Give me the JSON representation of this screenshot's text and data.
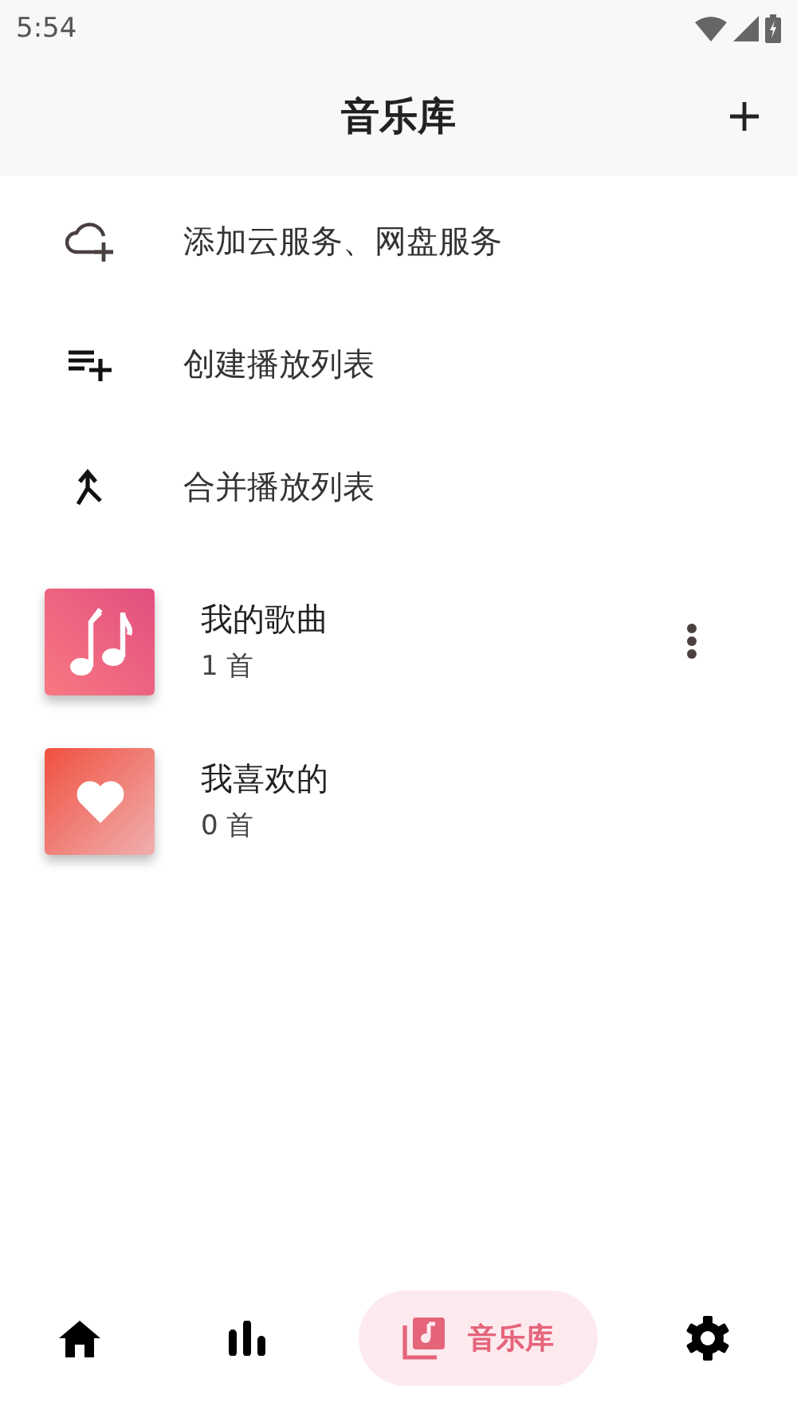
{
  "status_bar": {
    "time": "5:54"
  },
  "header": {
    "title": "音乐库"
  },
  "actions": [
    {
      "kind": "cloud",
      "label": "添加云服务、网盘服务"
    },
    {
      "kind": "playlist-add",
      "label": "创建播放列表"
    },
    {
      "kind": "merge",
      "label": "合并播放列表"
    }
  ],
  "playlists": [
    {
      "kind": "music",
      "name": "我的歌曲",
      "count": "1 首",
      "menu": true
    },
    {
      "kind": "heart",
      "name": "我喜欢的",
      "count": "0 首",
      "menu": false
    }
  ],
  "bottom_nav": [
    {
      "kind": "home",
      "selected": false
    },
    {
      "kind": "stats",
      "selected": false
    },
    {
      "kind": "library",
      "label": "音乐库",
      "selected": true
    },
    {
      "kind": "settings",
      "selected": false
    }
  ]
}
